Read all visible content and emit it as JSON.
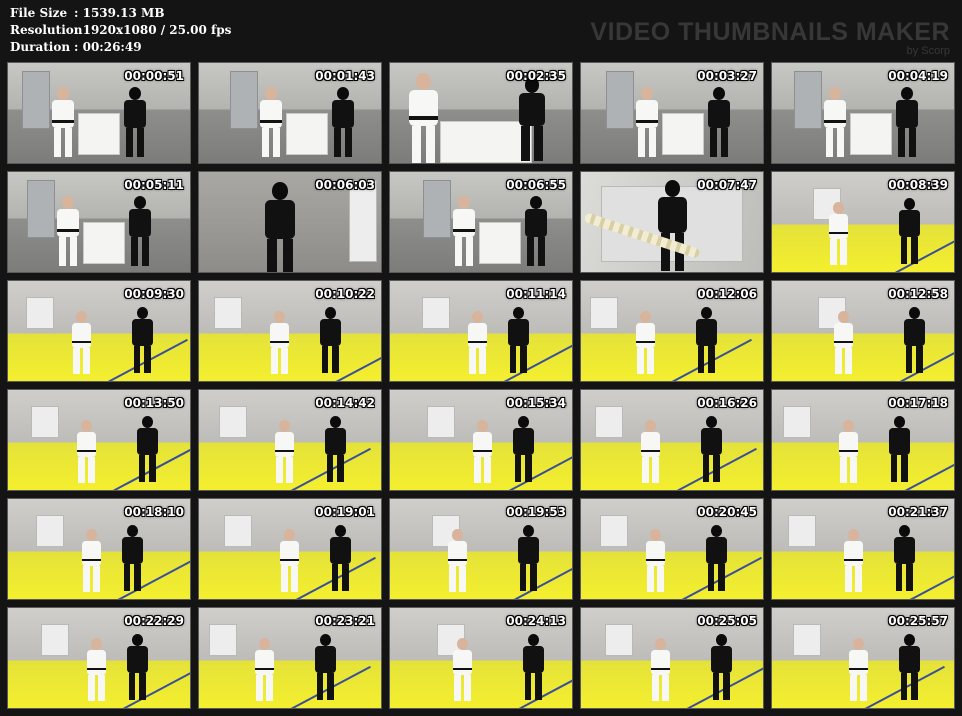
{
  "header": {
    "file_size_label": "File Size",
    "file_size_value": ": 1539.13 MB",
    "resolution_label": "Resolution",
    "resolution_value": ": 1920x1080 / 25.00 fps",
    "duration_label": "Duration",
    "duration_value": ": 00:26:49"
  },
  "brand": {
    "title": "VIDEO THUMBNAILS MAKER",
    "subtitle": "by Scorp"
  },
  "thumbnails": [
    {
      "time": "00:00:51",
      "scene": "table"
    },
    {
      "time": "00:01:43",
      "scene": "table-wide"
    },
    {
      "time": "00:02:35",
      "scene": "armwrestle"
    },
    {
      "time": "00:03:27",
      "scene": "table"
    },
    {
      "time": "00:04:19",
      "scene": "table"
    },
    {
      "time": "00:05:11",
      "scene": "table"
    },
    {
      "time": "00:06:03",
      "scene": "closeup"
    },
    {
      "time": "00:06:55",
      "scene": "table"
    },
    {
      "time": "00:07:47",
      "scene": "rope"
    },
    {
      "time": "00:08:39",
      "scene": "mat"
    },
    {
      "time": "00:09:30",
      "scene": "mat"
    },
    {
      "time": "00:10:22",
      "scene": "mat"
    },
    {
      "time": "00:11:14",
      "scene": "mat"
    },
    {
      "time": "00:12:06",
      "scene": "mat"
    },
    {
      "time": "00:12:58",
      "scene": "mat"
    },
    {
      "time": "00:13:50",
      "scene": "mat"
    },
    {
      "time": "00:14:42",
      "scene": "mat"
    },
    {
      "time": "00:15:34",
      "scene": "mat"
    },
    {
      "time": "00:16:26",
      "scene": "mat"
    },
    {
      "time": "00:17:18",
      "scene": "mat"
    },
    {
      "time": "00:18:10",
      "scene": "mat"
    },
    {
      "time": "00:19:01",
      "scene": "mat"
    },
    {
      "time": "00:19:53",
      "scene": "mat"
    },
    {
      "time": "00:20:45",
      "scene": "mat"
    },
    {
      "time": "00:21:37",
      "scene": "mat"
    },
    {
      "time": "00:22:29",
      "scene": "mat"
    },
    {
      "time": "00:23:21",
      "scene": "mat"
    },
    {
      "time": "00:24:13",
      "scene": "mat"
    },
    {
      "time": "00:25:05",
      "scene": "mat"
    },
    {
      "time": "00:25:57",
      "scene": "mat"
    }
  ],
  "colors": {
    "background": "#141414",
    "mat_yellow": "#f4ef2e",
    "gi_white": "#f7f7f5",
    "black_outfit": "#111111",
    "brand_text": "#373737"
  }
}
